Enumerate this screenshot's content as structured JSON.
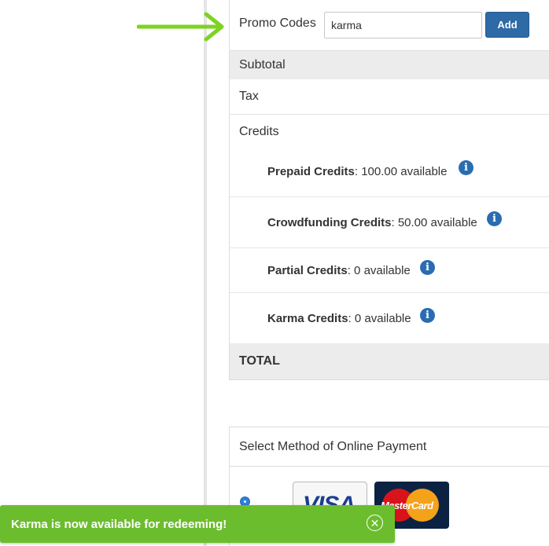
{
  "promo": {
    "label": "Promo Codes",
    "input_value": "karma",
    "add_label": "Add"
  },
  "summary": {
    "subtotal_label": "Subtotal",
    "tax_label": "Tax",
    "credits_label": "Credits",
    "credits": [
      {
        "name": "Prepaid Credits",
        "detail": ": 100.00 available",
        "icon": "info-icon"
      },
      {
        "name": "Crowdfunding Credits",
        "detail": ": 50.00 available",
        "icon": "info-icon"
      },
      {
        "name": "Partial Credits",
        "detail": ": 0 available",
        "icon": "info-icon"
      },
      {
        "name": "Karma Credits",
        "detail": ": 0 available",
        "icon": "info-icon"
      }
    ],
    "total_label": "TOTAL"
  },
  "payment": {
    "title": "Select Method of Online Payment",
    "visa_text": "VISA",
    "mastercard_text": "MasterCard"
  },
  "toast": {
    "message": "Karma is now available for redeeming!",
    "close_icon": "close-circle-icon"
  },
  "colors": {
    "accent_blue": "#2d6aa6",
    "toast_green": "#6cbd2e",
    "arrow_green": "#7ed321",
    "row_gray": "#ececec"
  }
}
